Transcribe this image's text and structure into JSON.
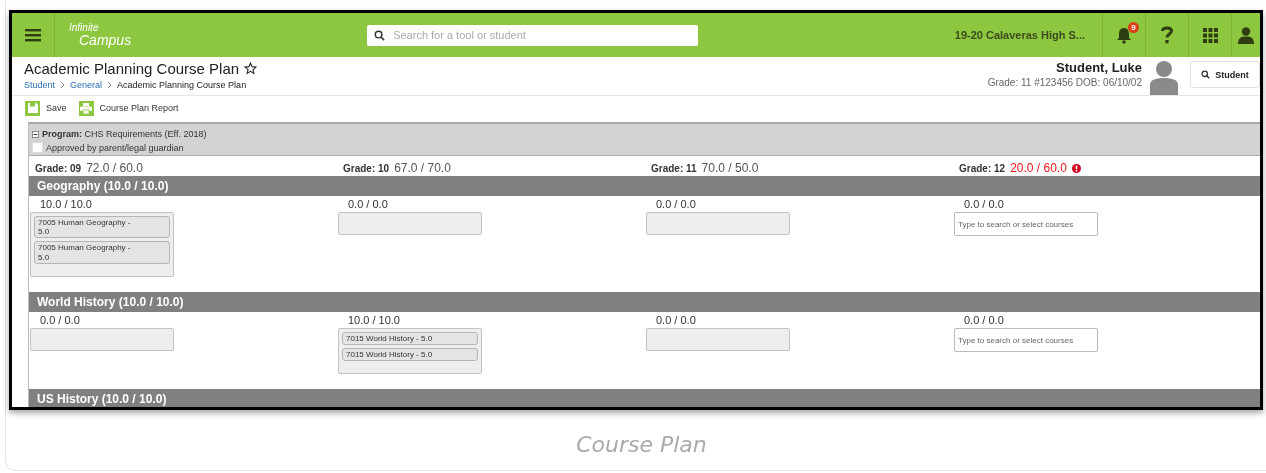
{
  "header": {
    "logo": [
      "Infinite",
      "Campus"
    ],
    "search": {
      "placeholder": "Search for a tool or student"
    },
    "school": "19-20 Calaveras High S...",
    "notifications": "9"
  },
  "page": {
    "title": "Academic Planning Course Plan",
    "breadcrumbs": [
      {
        "label": "Student",
        "link": true
      },
      {
        "label": "General",
        "link": true
      },
      {
        "label": "Academic Planning Course Plan",
        "link": false
      }
    ]
  },
  "student": {
    "name": "Student, Luke",
    "details": "Grade: 11 #123456 DOB: 06/10/02",
    "search_button": "Student"
  },
  "toolbar": [
    {
      "label": "Save",
      "kind": "save"
    },
    {
      "label": "Course Plan Report",
      "kind": "print"
    }
  ],
  "program": {
    "label": "Program:",
    "name": "CHS Requirements (Eff. 2018)",
    "expanded": true,
    "approval": {
      "label": "Approved by parent/legal guardian",
      "checked": false
    }
  },
  "grades": [
    {
      "label": "Grade: 09",
      "credits": "72.0 / 60.0",
      "deficient": false
    },
    {
      "label": "Grade: 10",
      "credits": "67.0 / 70.0",
      "deficient": false
    },
    {
      "label": "Grade: 11",
      "credits": "70.0 / 50.0",
      "deficient": false
    },
    {
      "label": "Grade: 12",
      "credits": "20.0 / 60.0",
      "deficient": true
    }
  ],
  "categories": [
    {
      "title": "Geography (10.0 / 10.0)",
      "cells": [
        {
          "credits": "10.0 / 10.0",
          "kind": "list",
          "courses": [
            "7005 Human Geography - 5.0",
            "7005 Human Geography - 5.0"
          ]
        },
        {
          "credits": "0.0 / 0.0",
          "kind": "list"
        },
        {
          "credits": "0.0 / 0.0",
          "kind": "list"
        },
        {
          "credits": "0.0 / 0.0",
          "kind": "search",
          "placeholder": "Type to search or select courses"
        }
      ]
    },
    {
      "title": "World History (10.0 / 10.0)",
      "cells": [
        {
          "credits": "0.0 / 0.0",
          "kind": "list"
        },
        {
          "credits": "10.0 / 10.0",
          "kind": "list",
          "courses": [
            "7015 World History - 5.0",
            "7015 World History - 5.0"
          ]
        },
        {
          "credits": "0.0 / 0.0",
          "kind": "list"
        },
        {
          "credits": "0.0 / 0.0",
          "kind": "search",
          "placeholder": "Type to search or select courses"
        }
      ]
    },
    {
      "title": "US History (10.0 / 10.0)"
    }
  ],
  "caption": "Course Plan"
}
